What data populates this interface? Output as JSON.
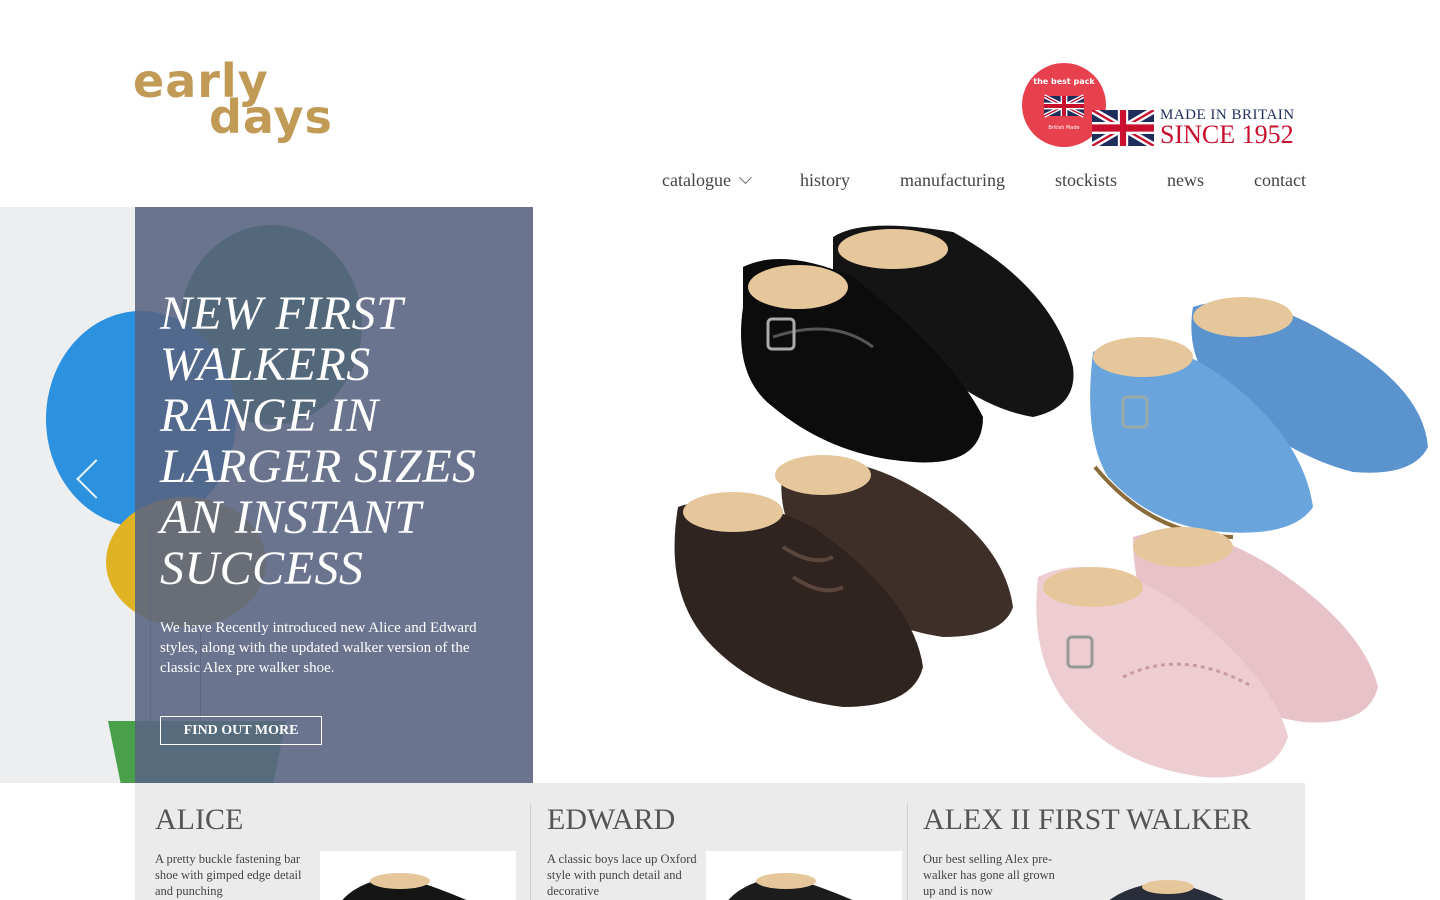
{
  "header": {
    "logo_line1": "early",
    "logo_line2": "days",
    "badge": {
      "top_text": "the best pack",
      "bottom_text": "British Made"
    },
    "made_in_britain": {
      "line1": "MADE IN BRITAIN",
      "line2": "SINCE 1952"
    },
    "nav": [
      {
        "label": "catalogue",
        "has_dropdown": true
      },
      {
        "label": "history"
      },
      {
        "label": "manufacturing"
      },
      {
        "label": "stockists"
      },
      {
        "label": "news"
      },
      {
        "label": "contact"
      }
    ]
  },
  "hero": {
    "title": "NEW FIRST WALKERS RANGE IN LARGER SIZES AN INSTANT SUCCESS",
    "text": "We have Recently introduced new Alice and Edward styles, along with the updated walker version of the classic Alex pre walker shoe.",
    "button": "FIND OUT MORE"
  },
  "products": [
    {
      "title": "ALICE",
      "desc": "A pretty buckle fastening bar shoe with gimped edge detail and punching"
    },
    {
      "title": "EDWARD",
      "desc": "A classic boys lace up Oxford style with punch detail and decorative"
    },
    {
      "title": "ALEX II FIRST WALKER",
      "desc": "Our best selling Alex pre-walker has gone all grown up and is now"
    }
  ],
  "colors": {
    "brand_gold": "#c19a56",
    "panel": "#586382",
    "union_red": "#c8102e",
    "union_blue": "#1e2d5c"
  }
}
